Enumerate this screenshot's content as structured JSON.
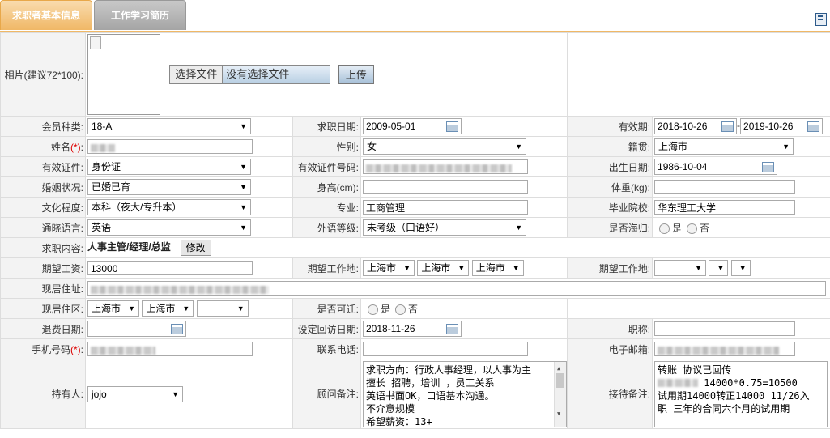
{
  "tabs": [
    {
      "label": "求职者基本信息"
    },
    {
      "label": "工作学习简历"
    }
  ],
  "photo": {
    "label": "相片(建议72*100):",
    "choose_btn": "选择文件",
    "no_file": "没有选择文件",
    "upload_btn": "上传"
  },
  "rows": {
    "member_type": {
      "label": "会员种类:",
      "value": "18-A"
    },
    "apply_date": {
      "label": "求职日期:",
      "value": "2009-05-01"
    },
    "valid_period": {
      "label": "有效期:",
      "from": "2018-10-26",
      "sep": "-",
      "to": "2019-10-26"
    },
    "name": {
      "label": "姓名",
      "req": "(*)",
      "suffix": ":"
    },
    "gender": {
      "label": "性别:",
      "value": "女"
    },
    "native": {
      "label": "籍贯:",
      "value": "上海市"
    },
    "id_type": {
      "label": "有效证件:",
      "value": "身份证"
    },
    "id_no": {
      "label": "有效证件号码:"
    },
    "birth": {
      "label": "出生日期:",
      "value": "1986-10-04"
    },
    "marital": {
      "label": "婚姻状况:",
      "value": "已婚已育"
    },
    "height": {
      "label": "身高(cm):",
      "value": ""
    },
    "weight": {
      "label": "体重(kg):",
      "value": ""
    },
    "education": {
      "label": "文化程度:",
      "value": "本科（夜大/专升本）"
    },
    "major": {
      "label": "专业:",
      "value": "工商管理"
    },
    "school": {
      "label": "毕业院校:",
      "value": "华东理工大学"
    },
    "language": {
      "label": "通晓语言:",
      "value": "英语"
    },
    "lang_level": {
      "label": "外语等级:",
      "value": "未考级（口语好）"
    },
    "overseas": {
      "label": "是否海归:",
      "yes": "是",
      "no": "否"
    },
    "job_content": {
      "label": "求职内容:",
      "value": "人事主管/经理/总监",
      "edit_btn": "修改"
    },
    "salary": {
      "label": "期望工资:",
      "value": "13000"
    },
    "work_place1": {
      "label": "期望工作地:",
      "v1": "上海市",
      "v2": "上海市",
      "v3": "上海市"
    },
    "work_place2": {
      "label": "期望工作地:"
    },
    "address": {
      "label": "现居住址:"
    },
    "district": {
      "label": "现居住区:",
      "v1": "上海市",
      "v2": "上海市"
    },
    "relocate": {
      "label": "是否可迁:",
      "yes": "是",
      "no": "否"
    },
    "refund_date": {
      "label": "退费日期:",
      "value": ""
    },
    "revisit_date": {
      "label": "设定回访日期:",
      "value": "2018-11-26"
    },
    "title": {
      "label": "职称:",
      "value": ""
    },
    "mobile": {
      "label": "手机号码",
      "req": "(*)",
      "suffix": ":"
    },
    "phone": {
      "label": "联系电话:",
      "value": ""
    },
    "email": {
      "label": "电子邮箱:"
    },
    "holder": {
      "label": "持有人:",
      "value": "jojo"
    },
    "consultant_note": {
      "label": "顾问备注:",
      "lines": [
        "求职方向：行政人事经理，以人事为主",
        "擅长 招聘，培训 ，员工关系",
        "英语书面OK，口语基本沟通。",
        "不介意规模",
        "希望薪资：13+"
      ]
    },
    "reception_note": {
      "label": "接待备注:",
      "lines": [
        "转账 协议已回传",
        "14000*0.75=10500",
        "试用期14000转正14000 11/26入",
        "职 三年的合同六个月的试用期"
      ]
    }
  }
}
